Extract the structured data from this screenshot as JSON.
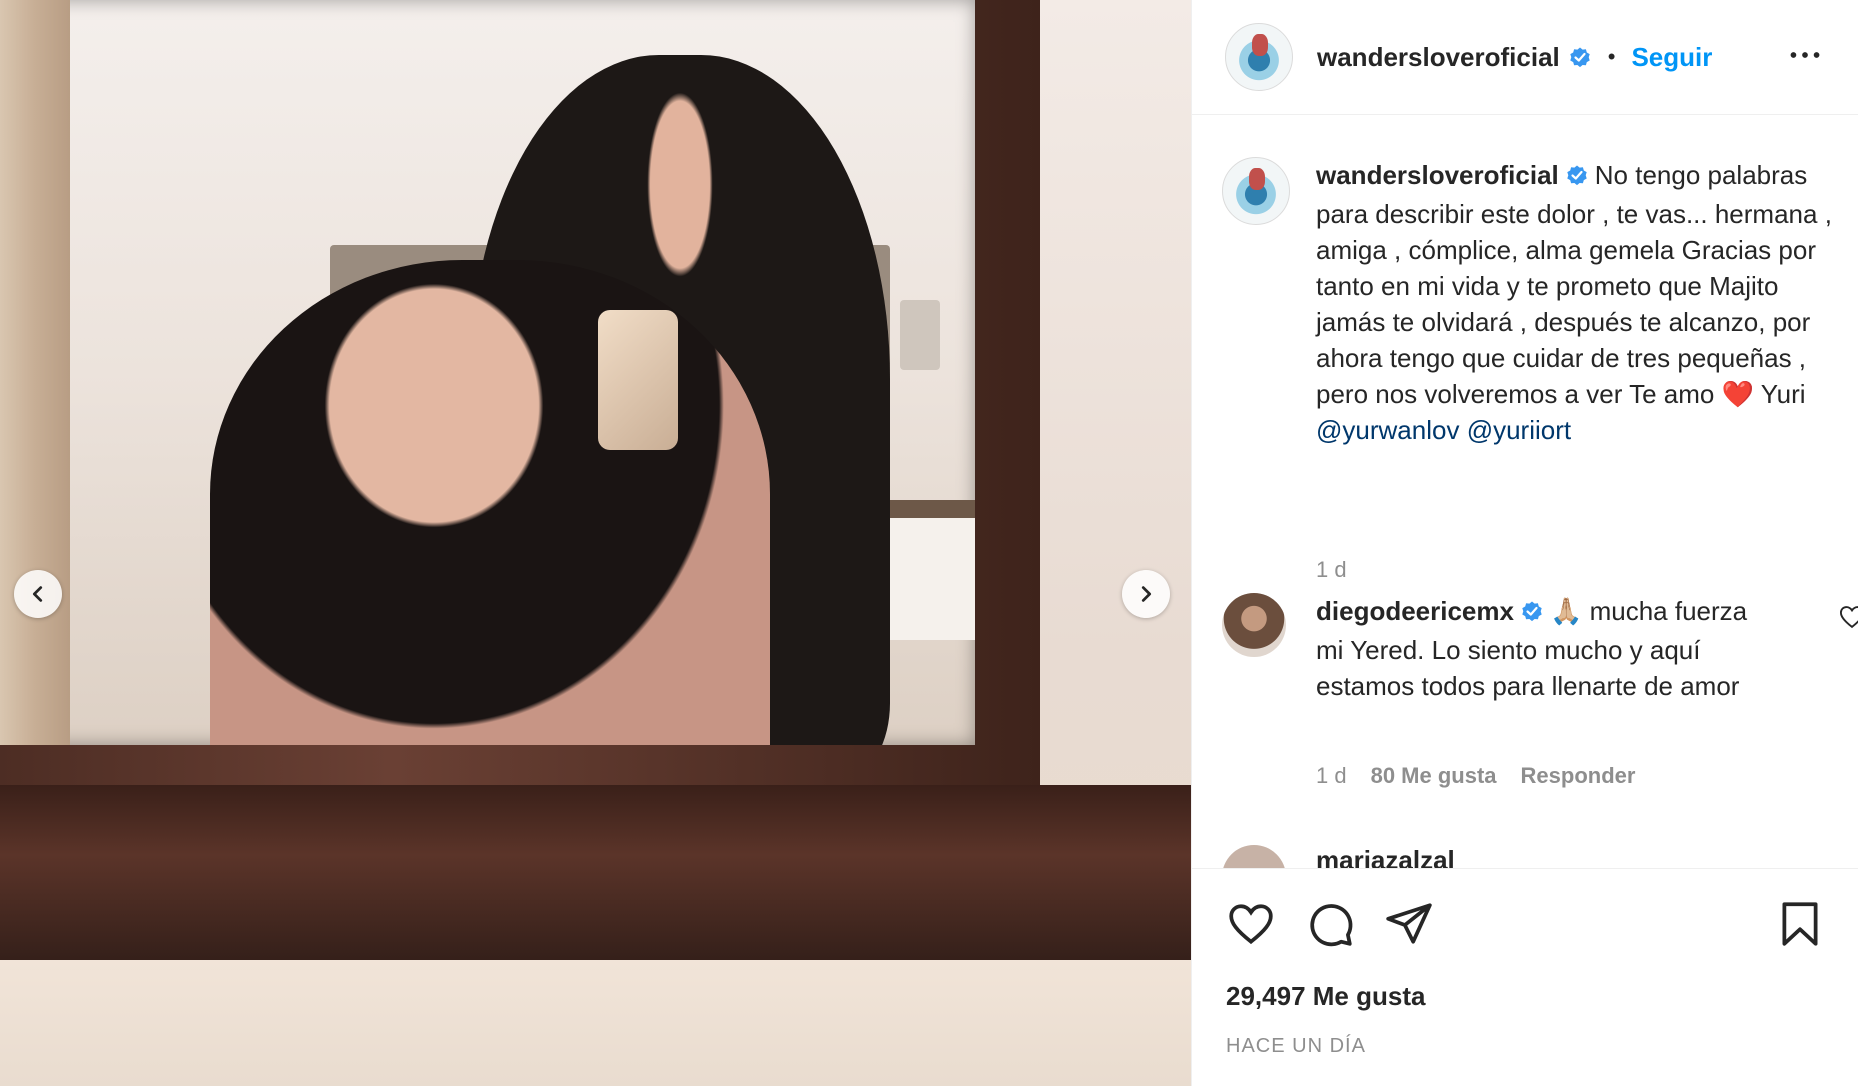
{
  "post": {
    "username": "wandersloveroficial",
    "separator": "•",
    "follow_label": "Seguir",
    "caption": {
      "text": "No tengo palabras para describir este dolor , te vas... hermana , amiga , cómplice, alma gemela Gracias por tanto en mi vida y te prometo que Majito jamás te olvidará , después te alcanzo, por ahora tengo que cuidar de tres pequeñas , pero nos volveremos a ver Te amo",
      "heart": "❤️",
      "after_heart": "Yuri",
      "mention_1": "@yurwanlov",
      "mention_2": "@yuriiort",
      "time": "1 d"
    },
    "comments": [
      {
        "username": "diegodeericemx",
        "emoji": "🙏🏼",
        "text": "mucha fuerza mi Yered. Lo siento mucho y aquí estamos todos para llenarte de amor",
        "time": "1 d",
        "likes": "80 Me gusta",
        "reply_label": "Responder"
      }
    ],
    "next_comment_partial": "mariazalzal",
    "likes_count": "29,497 Me gusta",
    "posted_ago": "HACE UN DÍA"
  },
  "icons": {
    "verified": "verified-badge-icon",
    "more": "more-options-icon",
    "prev": "chevron-left-icon",
    "next": "chevron-right-icon",
    "like": "heart-outline-icon",
    "comment": "comment-bubble-icon",
    "share": "paper-plane-icon",
    "save": "bookmark-icon"
  },
  "colors": {
    "link_blue": "#0095f6",
    "mention_blue": "#00376b",
    "text": "#262626",
    "muted": "#8e8e8e",
    "verified_blue": "#3897f0"
  }
}
